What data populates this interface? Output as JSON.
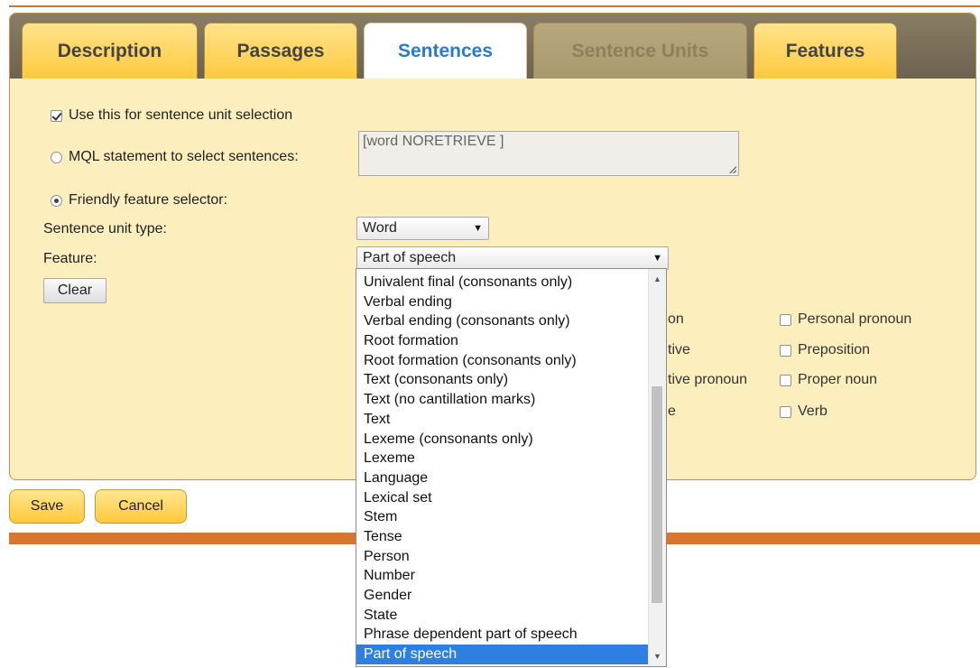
{
  "tabs": [
    {
      "label": "Description",
      "state": "normal"
    },
    {
      "label": "Passages",
      "state": "normal"
    },
    {
      "label": "Sentences",
      "state": "active"
    },
    {
      "label": "Sentence Units",
      "state": "disabled"
    },
    {
      "label": "Features",
      "state": "normal"
    }
  ],
  "form": {
    "use_for_selection_label": "Use this for sentence unit selection",
    "use_for_selection_checked": true,
    "mql_label": "MQL statement to select sentences:",
    "mql_value": "[word NORETRIEVE ]",
    "friendly_label": "Friendly feature selector:",
    "sentence_unit_type_label": "Sentence unit type:",
    "sentence_unit_type_value": "Word",
    "feature_label": "Feature:",
    "feature_value": "Part of speech",
    "clear_label": "Clear"
  },
  "pos_values": {
    "partial_col1": [
      "on",
      "tive",
      "tive pronoun",
      "e"
    ],
    "col2": [
      "Personal pronoun",
      "Preposition",
      "Proper noun",
      "Verb"
    ]
  },
  "buttons": {
    "save": "Save",
    "cancel": "Cancel"
  },
  "feature_dropdown": {
    "options": [
      "Univalent final (consonants only)",
      "Verbal ending",
      "Verbal ending (consonants only)",
      "Root formation",
      "Root formation (consonants only)",
      "Text (consonants only)",
      "Text (no cantillation marks)",
      "Text",
      "Lexeme (consonants only)",
      "Lexeme",
      "Language",
      "Lexical set",
      "Stem",
      "Tense",
      "Person",
      "Number",
      "Gender",
      "State",
      "Phrase dependent part of speech",
      "Part of speech"
    ],
    "selected": "Part of speech"
  },
  "colors": {
    "panel_bg": "#fdefbd",
    "tab_yellow": "#ffc93c",
    "active_tab_text": "#2b7bcc",
    "footer_bar": "#d7762f",
    "selected_option": "#2f7fe3"
  }
}
